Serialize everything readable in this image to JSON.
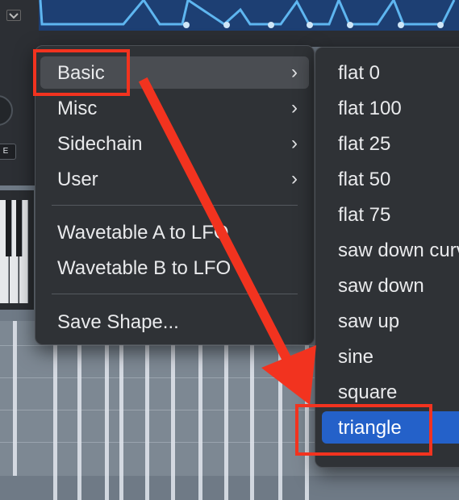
{
  "background": {
    "button_text": "E"
  },
  "main_menu": {
    "items": [
      {
        "label": "Basic",
        "has_submenu": true
      },
      {
        "label": "Misc",
        "has_submenu": true
      },
      {
        "label": "Sidechain",
        "has_submenu": true
      },
      {
        "label": "User",
        "has_submenu": true
      }
    ],
    "wavetable_items": [
      {
        "label": "Wavetable A to LFO"
      },
      {
        "label": "Wavetable B to LFO"
      }
    ],
    "save_label": "Save Shape...",
    "chevron": "›"
  },
  "submenu": {
    "items": [
      {
        "label": "flat 0"
      },
      {
        "label": "flat 100"
      },
      {
        "label": "flat 25"
      },
      {
        "label": "flat 50"
      },
      {
        "label": "flat 75"
      },
      {
        "label": "saw down curve"
      },
      {
        "label": "saw down"
      },
      {
        "label": "saw up"
      },
      {
        "label": "sine"
      },
      {
        "label": "square"
      },
      {
        "label": "triangle"
      }
    ],
    "selected_index": 10
  },
  "annotation": {
    "color": "#f2331f",
    "hover_color": "#4a4d52",
    "selected_color": "#2461c9"
  }
}
